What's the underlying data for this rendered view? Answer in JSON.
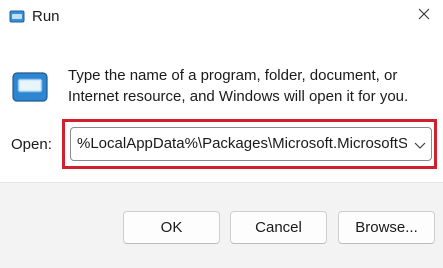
{
  "window": {
    "title": "Run",
    "title_icon": "run-icon",
    "close_icon": "close-icon"
  },
  "body": {
    "app_icon": "run-window-icon",
    "description": "Type the name of a program, folder, document, or Internet resource, and Windows will open it for you."
  },
  "open_field": {
    "label": "Open:",
    "value": "%LocalAppData%\\Packages\\Microsoft.MicrosoftSt",
    "dropdown_icon": "chevron-down-icon",
    "highlight_color": "#d21f2c"
  },
  "buttons": {
    "ok": "OK",
    "cancel": "Cancel",
    "browse": "Browse..."
  }
}
